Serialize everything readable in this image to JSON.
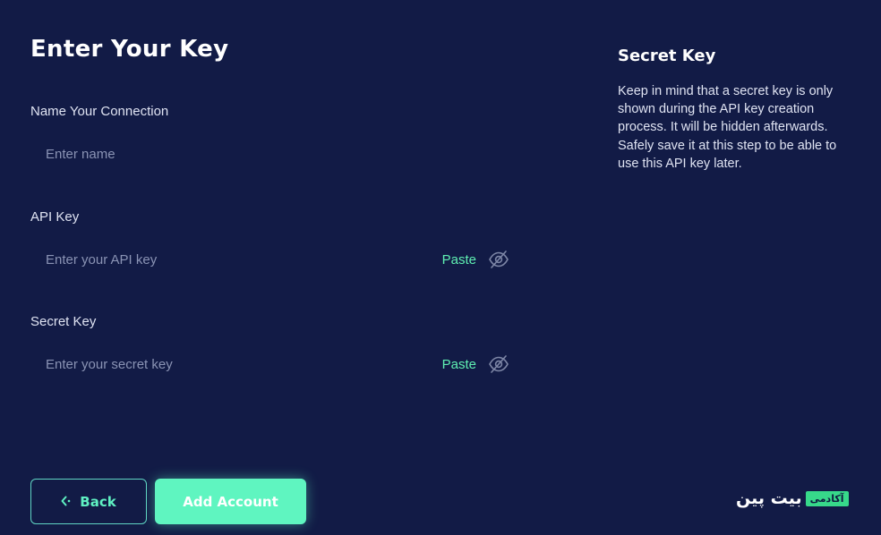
{
  "page": {
    "title": "Enter Your Key"
  },
  "form": {
    "connection": {
      "label": "Name Your Connection",
      "placeholder": "Enter name",
      "value": ""
    },
    "api_key": {
      "label": "API Key",
      "placeholder": "Enter your API key",
      "value": "",
      "paste_label": "Paste",
      "visibility_icon": "eye-off-icon"
    },
    "secret_key": {
      "label": "Secret Key",
      "placeholder": "Enter your secret key",
      "value": "",
      "paste_label": "Paste",
      "visibility_icon": "eye-off-icon"
    }
  },
  "info": {
    "title": "Secret Key",
    "text": "Keep in mind that a secret key is only shown during the API key creation process. It will be hidden afterwards. Safely save it at this step to be able to use this API key later."
  },
  "actions": {
    "back_label": "Back",
    "back_icon": "chevron-left-icon",
    "add_label": "Add Account"
  },
  "branding": {
    "logo_text": "بیت پین",
    "badge_text": "آکادمی"
  },
  "colors": {
    "background": "#121b46",
    "accent": "#5ff5c0",
    "paste_text": "#5ff0b2",
    "placeholder": "#8a93b4",
    "logo_badge": "#37d98a"
  }
}
